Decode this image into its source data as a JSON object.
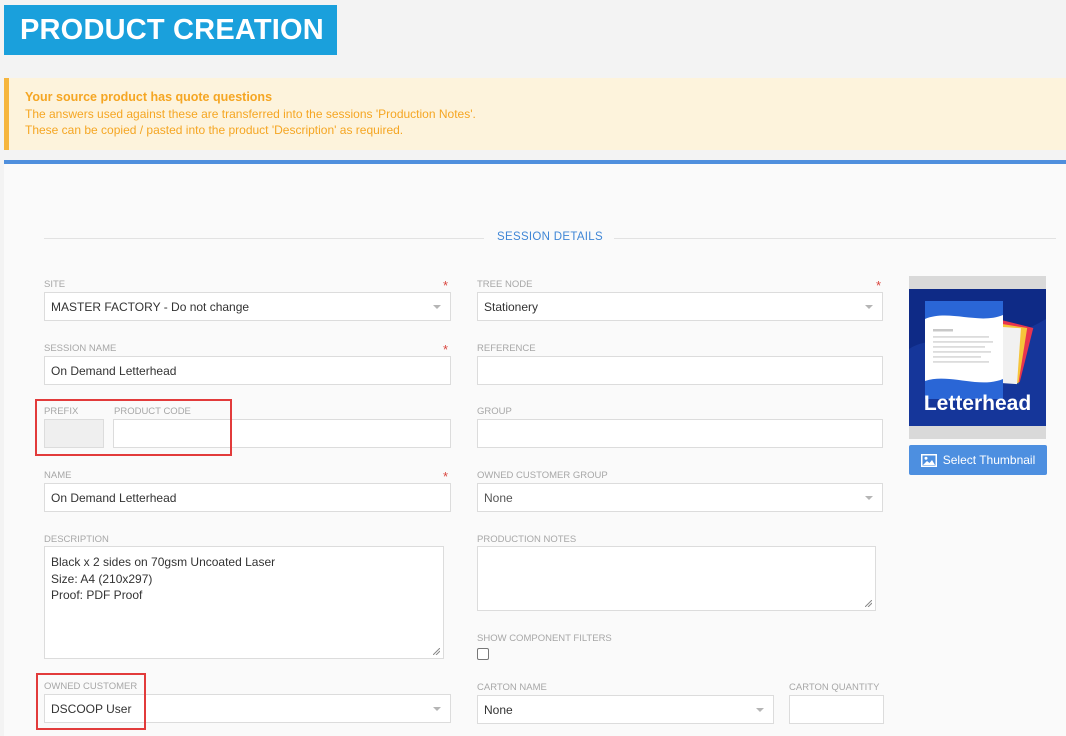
{
  "page": {
    "title": "PRODUCT CREATION"
  },
  "alert": {
    "title": "Your source product has quote questions",
    "line1": "The answers used against these are transferred into the sessions 'Production Notes'.",
    "line2": "These can be copied / pasted into the product 'Description' as required."
  },
  "section": {
    "title": "SESSION DETAILS"
  },
  "form": {
    "site": {
      "label": "SITE",
      "value": "MASTER FACTORY - Do not change",
      "required": "*"
    },
    "tree_node": {
      "label": "TREE NODE",
      "value": "Stationery",
      "required": "*"
    },
    "session_name": {
      "label": "SESSION NAME",
      "value": "On Demand Letterhead",
      "required": "*"
    },
    "reference": {
      "label": "REFERENCE",
      "value": ""
    },
    "prefix": {
      "label": "PREFIX",
      "value": ""
    },
    "product_code": {
      "label": "PRODUCT CODE",
      "value": ""
    },
    "group": {
      "label": "GROUP",
      "value": ""
    },
    "name": {
      "label": "NAME",
      "value": "On Demand Letterhead",
      "required": "*"
    },
    "owned_customer_group": {
      "label": "OWNED CUSTOMER GROUP",
      "value": "None"
    },
    "description": {
      "label": "DESCRIPTION",
      "lines": [
        "Black x 2 sides on 70gsm Uncoated Laser",
        "Size: A4 (210x297)",
        "Proof: PDF Proof"
      ]
    },
    "production_notes": {
      "label": "PRODUCTION NOTES",
      "value": ""
    },
    "show_component_filters": {
      "label": "SHOW COMPONENT FILTERS",
      "checked": false
    },
    "owned_customer": {
      "label": "OWNED CUSTOMER",
      "value": "DSCOOP User"
    },
    "carton_name": {
      "label": "CARTON NAME",
      "value": "None"
    },
    "carton_quantity": {
      "label": "CARTON QUANTITY",
      "value": ""
    }
  },
  "thumbnail": {
    "caption": "Letterhead",
    "button_label": "Select Thumbnail",
    "button_icon": "image-icon"
  },
  "colors": {
    "banner": "#1aa0dc",
    "alert_bg": "#fdf3dc",
    "alert_text": "#f5a623",
    "accent": "#4f8fdd",
    "required": "#d9453e",
    "highlight": "#e23b3b"
  }
}
